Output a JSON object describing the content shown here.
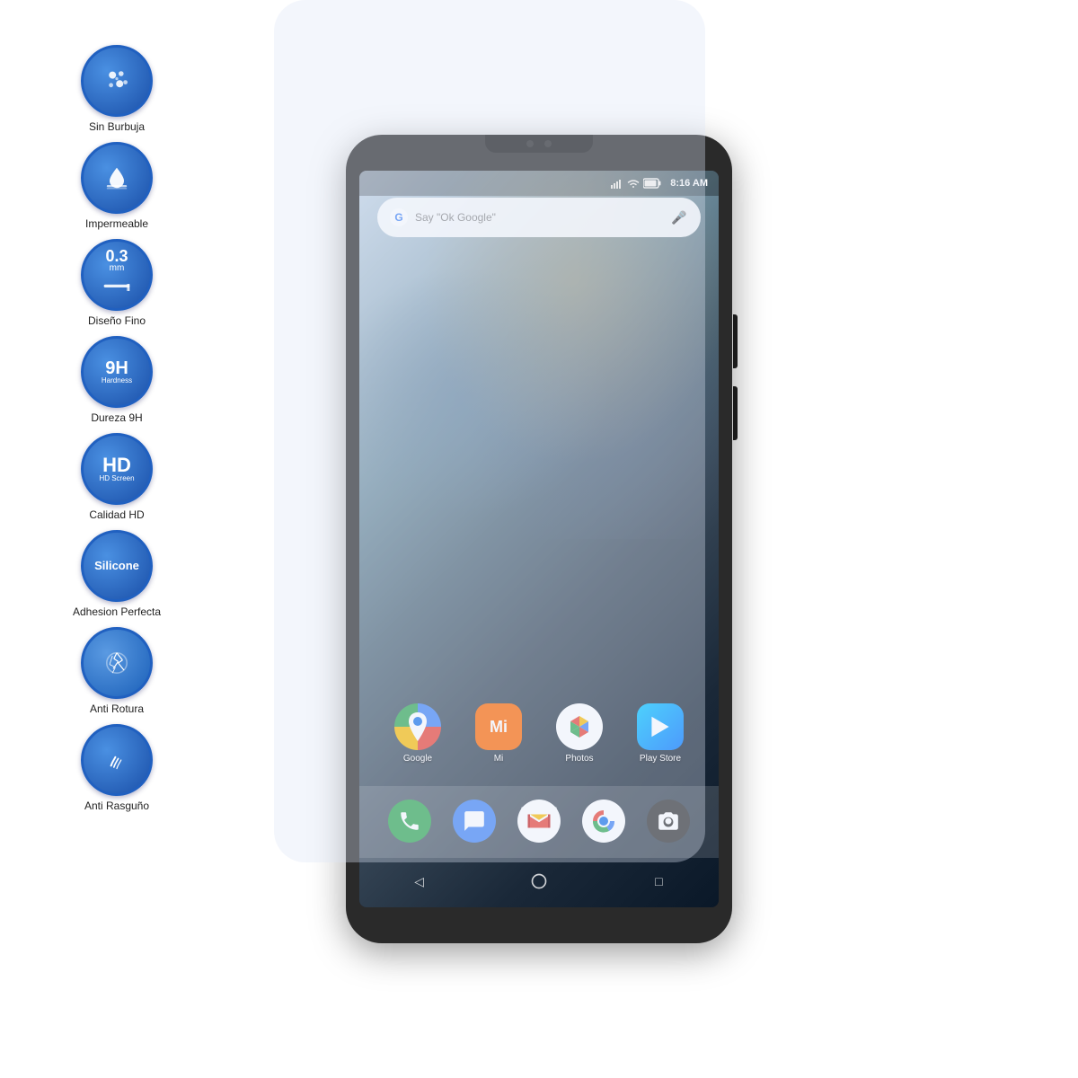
{
  "features": [
    {
      "id": "no-bubble",
      "label": "Sin Burbuja",
      "icon_type": "bubbles",
      "main_text": "",
      "sub_text": ""
    },
    {
      "id": "waterproof",
      "label": "Impermeable",
      "icon_type": "water",
      "main_text": "",
      "sub_text": ""
    },
    {
      "id": "thin-design",
      "label": "Diseño Fino",
      "icon_type": "thickness",
      "main_text": "0.3",
      "sub_text": "mm"
    },
    {
      "id": "hardness",
      "label": "Dureza 9H",
      "icon_type": "hardness",
      "main_text": "9H",
      "sub_text": "Hardness"
    },
    {
      "id": "hd",
      "label": "Calidad HD",
      "icon_type": "hd",
      "main_text": "HD",
      "sub_text": "HD Screen"
    },
    {
      "id": "silicone",
      "label": "Adhesion Perfecta",
      "icon_type": "silicone",
      "main_text": "Silicone",
      "sub_text": ""
    },
    {
      "id": "anti-break",
      "label": "Anti Rotura",
      "icon_type": "crack",
      "main_text": "",
      "sub_text": ""
    },
    {
      "id": "anti-scratch",
      "label": "Anti Rasguño",
      "icon_type": "scratch",
      "main_text": "",
      "sub_text": ""
    }
  ],
  "phone": {
    "status_bar": {
      "time": "8:16 AM"
    },
    "search_bar": {
      "placeholder": "Say \"Ok Google\""
    },
    "app_row": [
      {
        "name": "Google",
        "icon": "google-maps"
      },
      {
        "name": "Mi",
        "icon": "mi"
      },
      {
        "name": "Photos",
        "icon": "photos"
      },
      {
        "name": "Play Store",
        "icon": "play-store"
      }
    ],
    "dock": [
      {
        "name": "",
        "icon": "phone"
      },
      {
        "name": "",
        "icon": "messages"
      },
      {
        "name": "",
        "icon": "gmail"
      },
      {
        "name": "",
        "icon": "chrome"
      },
      {
        "name": "",
        "icon": "camera"
      }
    ],
    "nav": {
      "back": "◁",
      "home": "○",
      "recent": "□"
    }
  }
}
